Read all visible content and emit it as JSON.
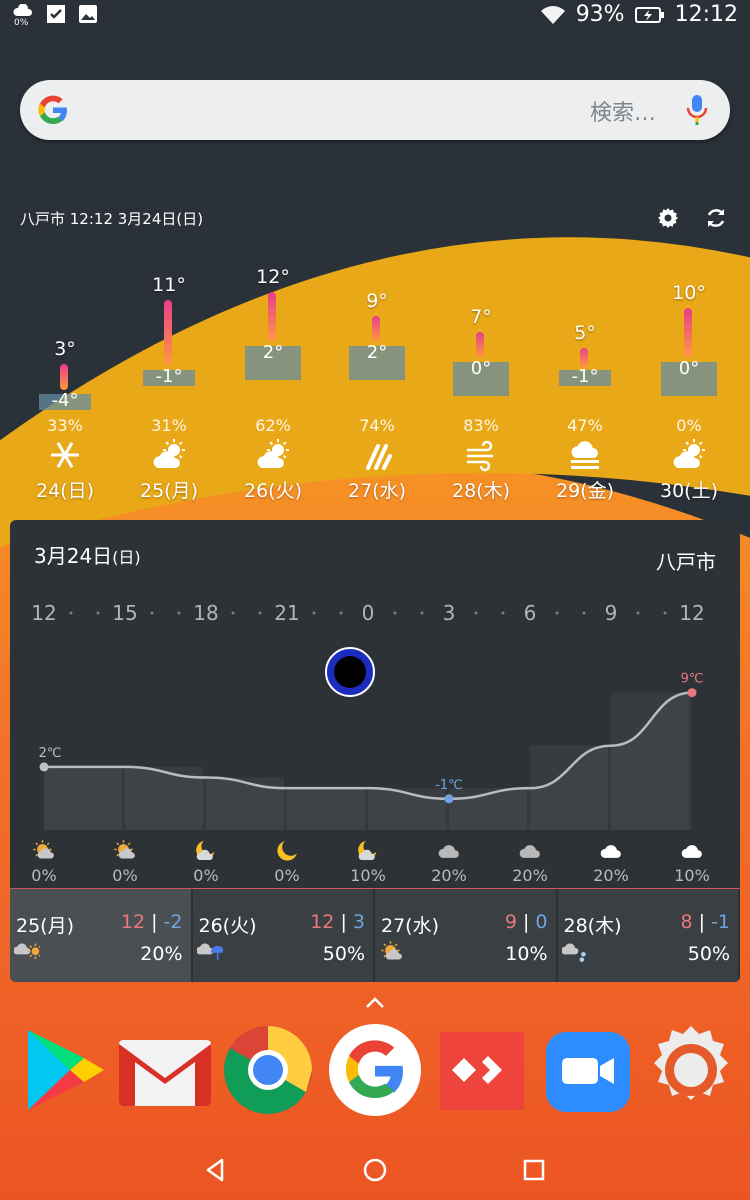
{
  "status_bar": {
    "left_icons": [
      "cloud-rain-icon",
      "check-box-icon",
      "image-icon"
    ],
    "cloud_badge": "0%",
    "battery_percent": "93%",
    "time": "12:12",
    "right_icons": [
      "wifi-icon",
      "battery-charging-icon"
    ]
  },
  "search": {
    "placeholder": "検索…"
  },
  "weekly": {
    "header": "八戸市  12:12  3月24日(日)",
    "days": [
      {
        "label": "24(日)",
        "hi": "3°",
        "lo": "-4°",
        "pop": "33%",
        "icon": "snowflake-icon"
      },
      {
        "label": "25(月)",
        "hi": "11°",
        "lo": "-1°",
        "pop": "31%",
        "icon": "partly-cloudy-sun-icon"
      },
      {
        "label": "26(火)",
        "hi": "12°",
        "lo": "2°",
        "pop": "62%",
        "icon": "partly-cloudy-sun-icon"
      },
      {
        "label": "27(水)",
        "hi": "9°",
        "lo": "2°",
        "pop": "74%",
        "icon": "rain-icon"
      },
      {
        "label": "28(木)",
        "hi": "7°",
        "lo": "0°",
        "pop": "83%",
        "icon": "wind-icon"
      },
      {
        "label": "29(金)",
        "hi": "5°",
        "lo": "-1°",
        "pop": "47%",
        "icon": "fog-icon"
      },
      {
        "label": "30(土)",
        "hi": "10°",
        "lo": "0°",
        "pop": "0%",
        "icon": "partly-cloudy-sun-icon"
      }
    ]
  },
  "hourly": {
    "date": "3月24日",
    "date_suffix": "(日)",
    "city": "八戸市",
    "chart_data": {
      "type": "area",
      "x": [
        "12",
        "15",
        "18",
        "21",
        "0",
        "3",
        "6",
        "9",
        "12"
      ],
      "temps": [
        2,
        2,
        1,
        0,
        0,
        -1,
        0,
        4,
        9
      ],
      "annotations": [
        {
          "index": 0,
          "text": "2℃"
        },
        {
          "index": 5,
          "text": "-1℃"
        },
        {
          "index": 8,
          "text": "9℃"
        }
      ]
    },
    "cells": [
      {
        "icon": "sun-cloud-icon",
        "pop": "0%"
      },
      {
        "icon": "sun-cloud-icon",
        "pop": "0%"
      },
      {
        "icon": "moon-cloud-icon",
        "pop": "0%"
      },
      {
        "icon": "moon-icon",
        "pop": "0%"
      },
      {
        "icon": "moon-cloud-icon",
        "pop": "10%"
      },
      {
        "icon": "cloud-icon",
        "pop": "20%"
      },
      {
        "icon": "cloud-icon",
        "pop": "20%"
      },
      {
        "icon": "white-cloud-icon",
        "pop": "20%"
      },
      {
        "icon": "white-cloud-icon",
        "pop": "10%"
      }
    ]
  },
  "forecast": [
    {
      "day": "25(月)",
      "hi": "12",
      "lo": "-2",
      "pop": "20%",
      "icon": "cloud-sun-icon"
    },
    {
      "day": "26(火)",
      "hi": "12",
      "lo": "3",
      "pop": "50%",
      "icon": "cloud-umbrella-icon"
    },
    {
      "day": "27(水)",
      "hi": "9",
      "lo": "0",
      "pop": "10%",
      "icon": "sun-cloud-icon"
    },
    {
      "day": "28(木)",
      "hi": "8",
      "lo": "-1",
      "pop": "50%",
      "icon": "cloud-snow-icon"
    }
  ],
  "separator": "|",
  "dock": [
    "play-store-icon",
    "gmail-icon",
    "chrome-icon",
    "google-icon",
    "anydesk-icon",
    "zoom-icon",
    "settings-icon"
  ],
  "nav": [
    "back-icon",
    "home-icon",
    "recents-icon"
  ],
  "colors": {
    "accent_yellow": "#e9a817",
    "accent_orange": "#f4822a",
    "deep_orange": "#ee5a24",
    "hi_temp": "#e8787a",
    "lo_temp": "#6fa4e0"
  }
}
